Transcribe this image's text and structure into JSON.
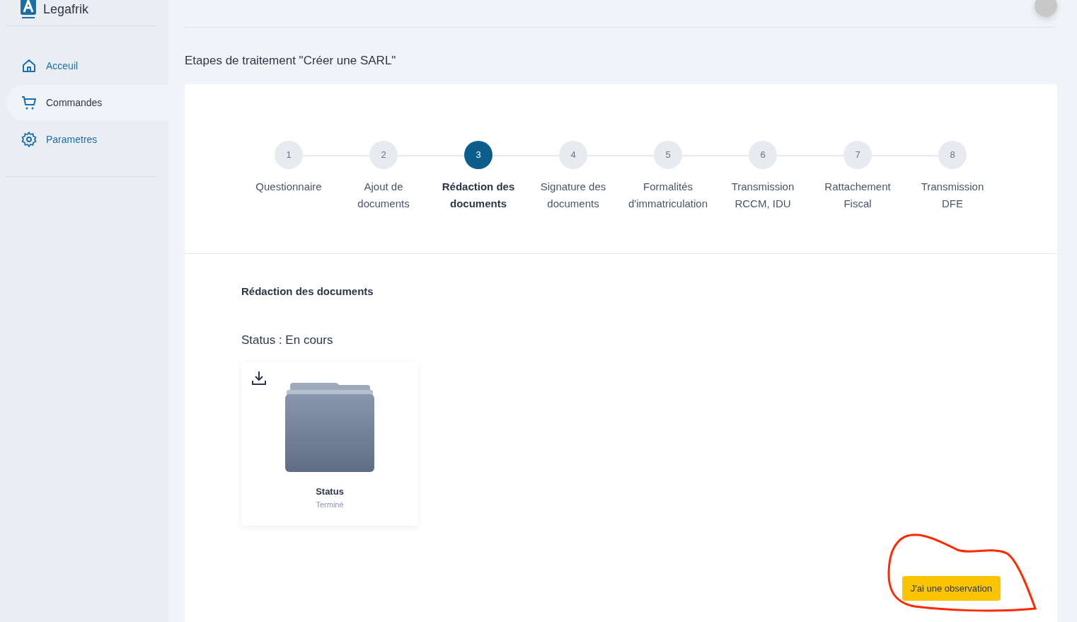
{
  "brand": {
    "name": "Legafrik"
  },
  "sidebar": {
    "items": [
      {
        "label": "Acceuil",
        "selected": false
      },
      {
        "label": "Commandes",
        "selected": true
      },
      {
        "label": "Parametres",
        "selected": false
      }
    ]
  },
  "page_title": "Etapes de traitement \"Créer une SARL\"",
  "steps": [
    {
      "number": "1",
      "label": "Questionnaire",
      "selected": false
    },
    {
      "number": "2",
      "label": "Ajout de documents",
      "selected": false
    },
    {
      "number": "3",
      "label": "Rédaction des documents",
      "selected": true
    },
    {
      "number": "4",
      "label": "Signature des documents",
      "selected": false
    },
    {
      "number": "5",
      "label": "Formalités d'immatriculation",
      "selected": false
    },
    {
      "number": "6",
      "label": "Transmission RCCM, IDU",
      "selected": false
    },
    {
      "number": "7",
      "label": "Rattachement Fiscal",
      "selected": false
    },
    {
      "number": "8",
      "label": "Transmission DFE",
      "selected": false
    }
  ],
  "step_detail": {
    "title": "Rédaction des documents",
    "status": "Status : En cours",
    "documents": [
      {
        "name": "Status",
        "state": "Terminé"
      }
    ]
  },
  "observation_button": "J'ai une observation"
}
